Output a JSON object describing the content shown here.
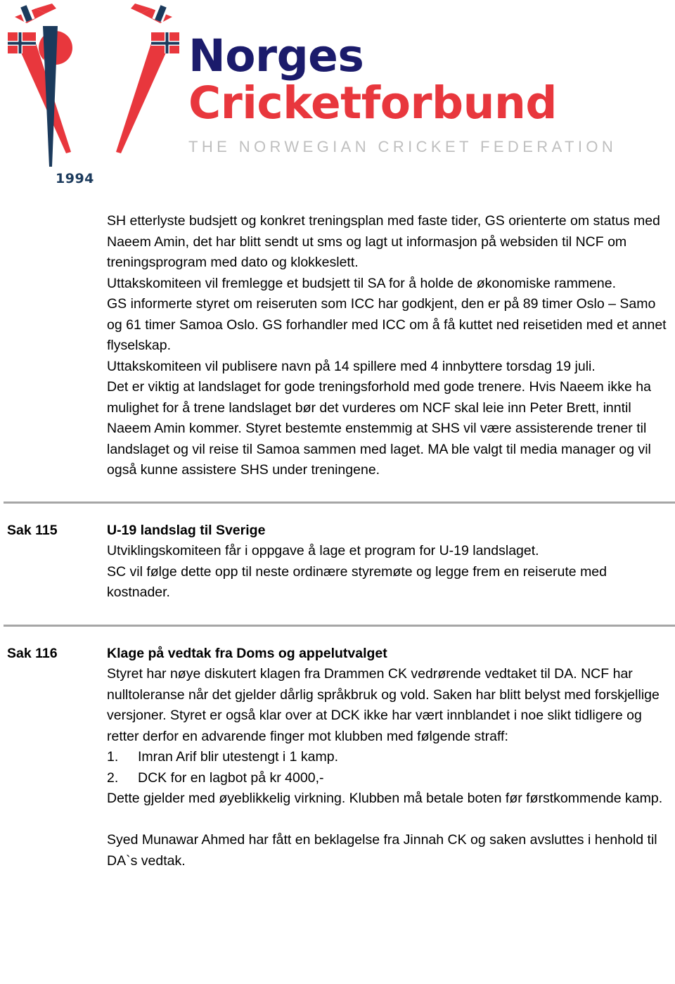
{
  "logo": {
    "emblem_name": "norges-cricketforbund-emblem",
    "year": "1994",
    "wordmark_line1": "Norges",
    "wordmark_line2": "Cricketforbund",
    "subtitle": "THE NORWEGIAN CRICKET FEDERATION",
    "colors": {
      "navy": "#1b1b6b",
      "red": "#e8373d",
      "subtitle_gray": "#bfbfbf",
      "year_navy": "#1b3a5c",
      "rule_gray": "#a6a6a6"
    }
  },
  "document": {
    "intro": {
      "paragraphs": [
        "SH etterlyste budsjett og konkret treningsplan med faste tider, GS orienterte om status med Naeem Amin, det har blitt sendt ut sms og lagt ut informasjon på websiden til NCF om treningsprogram med dato og klokkeslett.",
        "Uttakskomiteen vil fremlegge et budsjett til SA for å holde de økonomiske rammene.",
        "GS informerte styret om reiseruten som ICC har godkjent, den er på 89 timer Oslo – Samo og 61 timer Samoa Oslo. GS forhandler med ICC om å få kuttet ned reisetiden med et annet flyselskap.",
        "Uttakskomiteen vil publisere navn på 14 spillere med 4 innbyttere torsdag 19 juli.",
        "Det er viktig at landslaget for gode treningsforhold med gode trenere. Hvis Naeem ikke ha mulighet for å trene landslaget bør det vurderes om NCF skal leie inn Peter Brett, inntil Naeem Amin kommer. Styret bestemte enstemmig at SHS vil være assisterende trener til landslaget og vil reise til Samoa sammen med laget. MA ble valgt til media manager og vil også kunne assistere SHS under treningene."
      ]
    },
    "sections": [
      {
        "id": "sak-115",
        "label": "Sak 115",
        "heading": "U-19 landslag til Sverige",
        "paragraphs": [
          "Utviklingskomiteen får i oppgave å lage et program for U-19 landslaget.",
          "SC vil følge dette opp til neste ordinære styremøte og legge frem en reiserute med kostnader."
        ]
      },
      {
        "id": "sak-116",
        "label": "Sak 116",
        "heading": "Klage på vedtak fra Doms og appelutvalget",
        "paragraphs": [
          "Styret har nøye diskutert klagen fra Drammen CK vedrørende vedtaket til DA. NCF har nulltoleranse når det gjelder dårlig språkbruk og vold. Saken har blitt belyst med forskjellige versjoner. Styret er også klar over at DCK ikke har vært innblandet i noe slikt tidligere og retter derfor en advarende finger mot klubben med følgende straff:"
        ],
        "list": [
          {
            "num": "1.",
            "text": "Imran Arif blir utestengt i 1 kamp."
          },
          {
            "num": "2.",
            "text": "DCK for en lagbot på kr 4000,-"
          }
        ],
        "paragraphs_after": [
          "Dette gjelder med øyeblikkelig virkning. Klubben må betale boten før førstkommende kamp."
        ],
        "closing": [
          "Syed Munawar Ahmed har fått en beklagelse fra Jinnah CK og saken avsluttes i henhold til DA`s vedtak."
        ]
      }
    ]
  }
}
